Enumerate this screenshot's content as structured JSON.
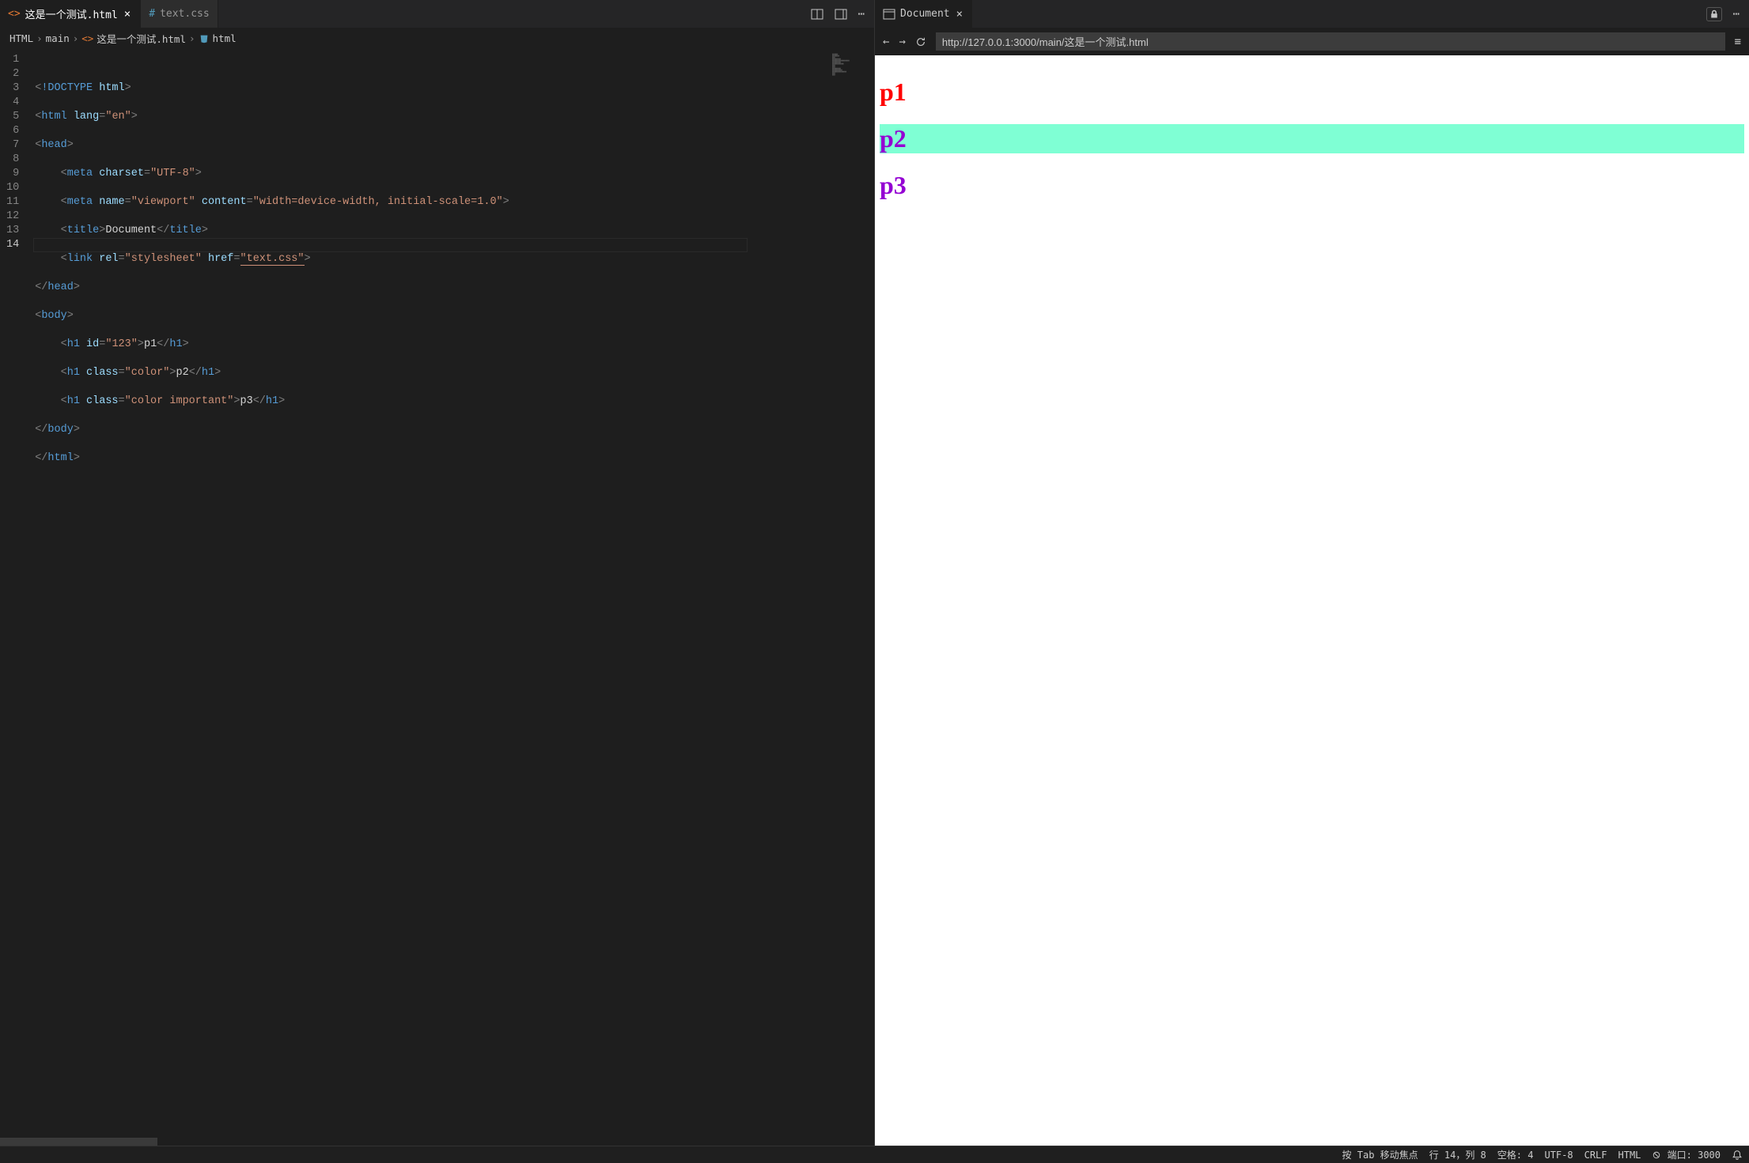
{
  "editor": {
    "tabs": [
      {
        "label": "这是一个测试.html",
        "active": true,
        "dirty": true,
        "kind": "html"
      },
      {
        "label": "text.css",
        "active": false,
        "dirty": false,
        "kind": "css"
      }
    ],
    "breadcrumbs": {
      "parts": [
        "HTML",
        "main",
        "这是一个测试.html",
        "html"
      ]
    },
    "line_numbers": [
      "1",
      "2",
      "3",
      "4",
      "5",
      "6",
      "7",
      "8",
      "9",
      "10",
      "11",
      "12",
      "13",
      "14"
    ],
    "active_line": 14,
    "code": {
      "l1": {
        "doctype": "!DOCTYPE",
        "kw": "html"
      },
      "l2": {
        "tag": "html",
        "attr": "lang",
        "val": "\"en\""
      },
      "l3": {
        "tag": "head"
      },
      "l4": {
        "tag": "meta",
        "attr": "charset",
        "val": "\"UTF-8\""
      },
      "l5": {
        "tag": "meta",
        "attr1": "name",
        "val1": "\"viewport\"",
        "attr2": "content",
        "val2": "\"width=device-width, initial-scale=1.0\""
      },
      "l6": {
        "open": "title",
        "text": "Document",
        "close": "title"
      },
      "l7": {
        "tag": "link",
        "attr1": "rel",
        "val1": "\"stylesheet\"",
        "attr2": "href",
        "val2": "\"text.css\""
      },
      "l8": {
        "close": "head"
      },
      "l9": {
        "tag": "body"
      },
      "l10": {
        "tag": "h1",
        "attr": "id",
        "val": "\"123\"",
        "text": "p1",
        "close": "h1"
      },
      "l11": {
        "tag": "h1",
        "attr": "class",
        "val": "\"color\"",
        "text": "p2",
        "close": "h1"
      },
      "l12": {
        "tag": "h1",
        "attr": "class",
        "val": "\"color important\"",
        "text": "p3",
        "close": "h1"
      },
      "l13": {
        "close": "body"
      },
      "l14": {
        "close": "html"
      }
    }
  },
  "preview": {
    "tab_label": "Document",
    "url": "http://127.0.0.1:3000/main/这是一个测试.html",
    "headings": {
      "p1": "p1",
      "p2": "p2",
      "p3": "p3"
    }
  },
  "statusbar": {
    "tab_hint": "按 Tab 移动焦点",
    "cursor": "行 14，列 8",
    "spaces": "空格: 4",
    "encoding": "UTF-8",
    "eol": "CRLF",
    "language": "HTML",
    "port": "端口: 3000"
  },
  "glyphs": {
    "close": "×",
    "more": "⋯",
    "chevron": "›",
    "hamburger": "≡",
    "back": "←",
    "forward": "→",
    "dirty": "●"
  }
}
